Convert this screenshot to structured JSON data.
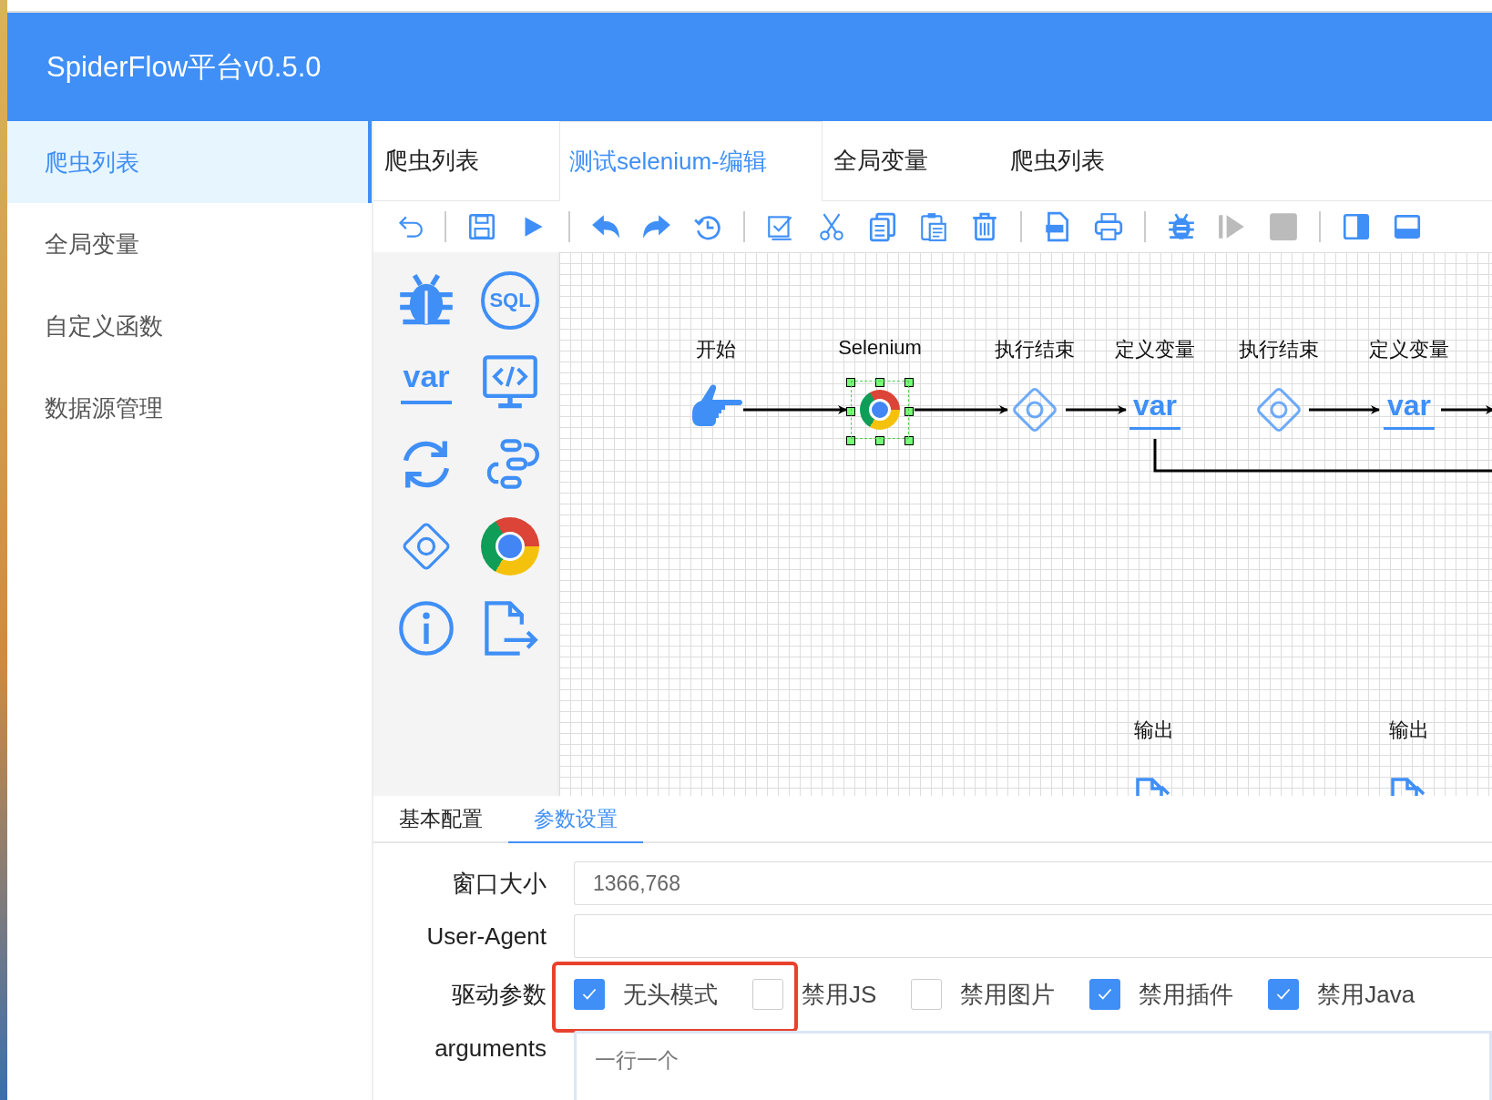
{
  "app_title": "SpiderFlow平台v0.5.0",
  "sidebar": {
    "items": [
      {
        "label": "爬虫列表",
        "selected": true
      },
      {
        "label": "全局变量",
        "selected": false
      },
      {
        "label": "自定义函数",
        "selected": false
      },
      {
        "label": "数据源管理",
        "selected": false
      }
    ]
  },
  "tabs": [
    {
      "label": "爬虫列表",
      "selected": false
    },
    {
      "label": "测试selenium-编辑",
      "selected": true
    },
    {
      "label": "全局变量",
      "selected": false
    },
    {
      "label": "爬虫列表",
      "selected": false
    }
  ],
  "palette": [
    {
      "kind": "bug"
    },
    {
      "kind": "sql",
      "text": "SQL"
    },
    {
      "kind": "var",
      "text": "var"
    },
    {
      "kind": "code"
    },
    {
      "kind": "loop"
    },
    {
      "kind": "process"
    },
    {
      "kind": "diamond"
    },
    {
      "kind": "chrome"
    },
    {
      "kind": "info"
    },
    {
      "kind": "output"
    }
  ],
  "canvas": {
    "nodes": [
      {
        "label": "开始",
        "kind": "start",
        "selected": false
      },
      {
        "label": "Selenium",
        "kind": "chrome",
        "selected": true
      },
      {
        "label": "执行结束",
        "kind": "diamond",
        "selected": false
      },
      {
        "label": "定义变量",
        "kind": "var",
        "text": "var",
        "selected": false
      },
      {
        "label": "执行结束",
        "kind": "diamond",
        "selected": false
      },
      {
        "label": "定义变量",
        "kind": "var",
        "text": "var",
        "selected": false
      }
    ],
    "outputs": [
      {
        "label": "输出"
      },
      {
        "label": "输出"
      }
    ]
  },
  "config_tabs": [
    {
      "label": "基本配置",
      "selected": false
    },
    {
      "label": "参数设置",
      "selected": true
    }
  ],
  "form": {
    "window_size": {
      "label": "窗口大小",
      "value": "1366,768"
    },
    "user_agent": {
      "label": "User-Agent"
    },
    "driver_params": {
      "label": "驱动参数",
      "options": [
        {
          "label": "无头模式",
          "checked": true
        },
        {
          "label": "禁用JS",
          "checked": false
        },
        {
          "label": "禁用图片",
          "checked": false
        },
        {
          "label": "禁用插件",
          "checked": true
        },
        {
          "label": "禁用Java",
          "checked": true
        }
      ]
    },
    "arguments": {
      "label": "arguments",
      "placeholder": "一行一个"
    }
  }
}
